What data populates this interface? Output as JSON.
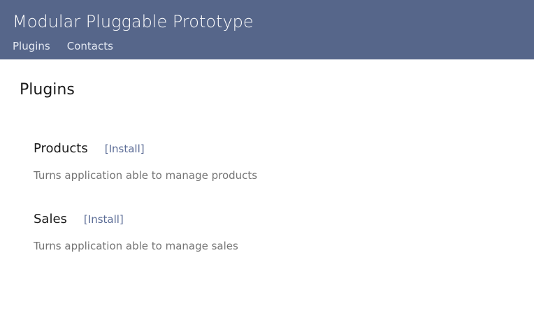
{
  "app": {
    "title": "Modular Pluggable Prototype"
  },
  "nav": {
    "items": [
      {
        "label": "Plugins"
      },
      {
        "label": "Contacts"
      }
    ]
  },
  "page": {
    "title": "Plugins"
  },
  "plugins": [
    {
      "name": "Products",
      "install_label": "[Install]",
      "description": "Turns application able to manage products"
    },
    {
      "name": "Sales",
      "install_label": "[Install]",
      "description": "Turns application able to manage sales"
    }
  ],
  "colors": {
    "header_bg": "#56668a",
    "link": "#5a6b95",
    "description": "#757575"
  }
}
